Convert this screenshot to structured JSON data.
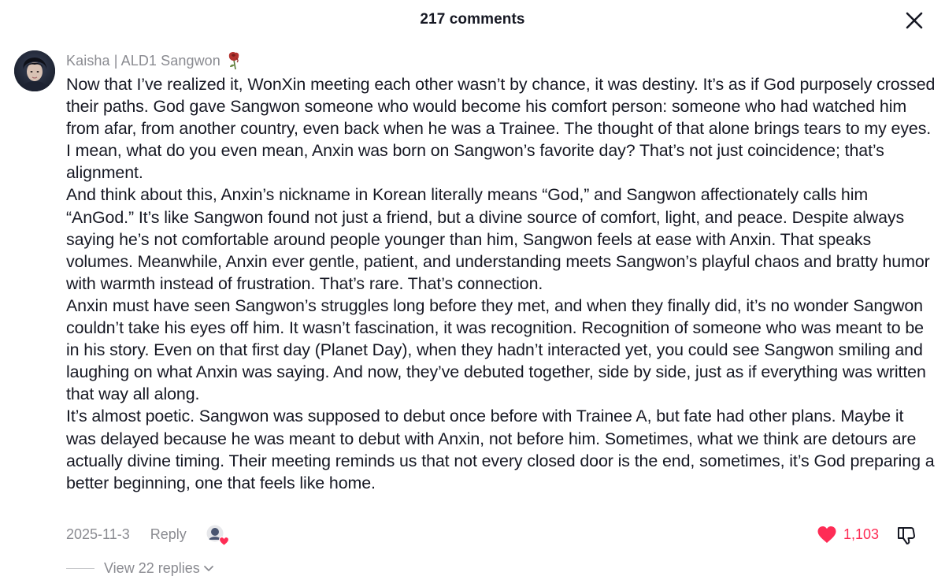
{
  "header": {
    "title": "217 comments",
    "close_icon": "close-icon"
  },
  "comment": {
    "author": "Kaisha | ALD1 Sangwon",
    "author_emoji_icon": "wilted-rose-icon",
    "paragraphs": [
      "Now that I’ve realized it, WonXin meeting each other wasn’t by chance, it was destiny. It’s as if God purposely crossed their paths. God gave Sangwon someone who would become his comfort person: someone who had watched him from afar, from another country, even back when he was a Trainee. The thought of that alone brings tears to my eyes. I mean, what do you even mean, Anxin was born on Sangwon’s favorite day? That’s not just coincidence; that’s alignment.",
      "And think about this, Anxin’s nickname in Korean literally means “God,” and Sangwon affectionately calls him “AnGod.” It’s like Sangwon found not just a friend, but a divine source of comfort, light, and peace. Despite always saying he’s not comfortable around people younger than him, Sangwon feels at ease with Anxin. That speaks volumes. Meanwhile, Anxin ever gentle, patient, and understanding meets Sangwon’s playful chaos and bratty humor with warmth instead of frustration. That’s rare. That’s connection.",
      "Anxin must have seen Sangwon’s struggles long before they met, and when they finally did, it’s no wonder Sangwon couldn’t take his eyes off him. It wasn’t fascination, it was recognition. Recognition of someone who was meant to be in his story. Even on that first day (Planet Day), when they hadn’t interacted yet, you could see Sangwon smiling and laughing on what Anxin was saying. And now, they’ve debuted together, side by side, just as if everything was written that way all along.",
      "It’s almost poetic. Sangwon was supposed to debut once before with Trainee A, but fate had other plans. Maybe it was delayed because he was meant to debut with Anxin, not before him. Sometimes, what we think are detours are actually divine timing. Their meeting reminds us that not every closed door is the end, sometimes, it’s God preparing a better beginning, one that feels like home."
    ],
    "date": "2025-11-3",
    "reply_label": "Reply",
    "like_count": "1,103",
    "like_color": "#fe2c55",
    "replies_label": "View 22 replies"
  }
}
